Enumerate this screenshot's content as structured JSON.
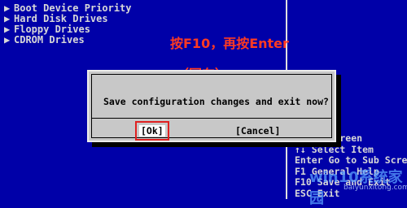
{
  "menu": {
    "items": [
      {
        "arrow": "▶",
        "label": "Boot Device Priority"
      },
      {
        "arrow": "▶",
        "label": "Hard Disk Drives"
      },
      {
        "arrow": "▶",
        "label": "Floppy Drives"
      },
      {
        "arrow": "▶",
        "label": "CDROM Drives"
      }
    ]
  },
  "annotation": {
    "line1": "按F10，再按Enter",
    "line2": "（回车）"
  },
  "dialog": {
    "message": "Save configuration changes and exit now?",
    "ok_label": "[Ok]",
    "cancel_label": "[Cancel]"
  },
  "help": {
    "lines": [
      "elect Screen",
      "↑↓    Select Item",
      "Enter Go to Sub Screen",
      "F1    General Help",
      "F10   Save and Exit",
      "ESC   Exit"
    ]
  },
  "watermark": {
    "text": "win10系统家园",
    "url": "baiyunxitong.com"
  },
  "colors": {
    "bios_bg": "#0000a8",
    "annotation": "#ff3a22",
    "dialog_bg": "#c8c8c8",
    "highlight": "#e02020"
  }
}
